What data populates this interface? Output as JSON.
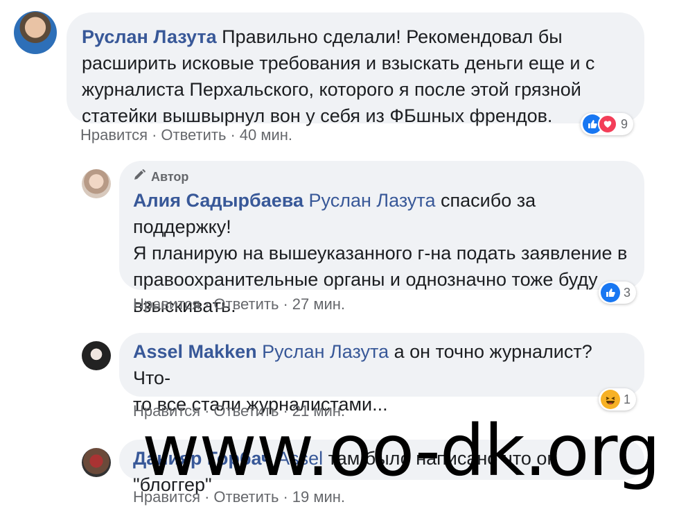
{
  "comments": [
    {
      "author": "Руслан Лазута",
      "mention": "",
      "line1": "Правильно сделали! Рекомендовал бы",
      "lines": [
        "расширить исковые требования и взыскать деньги еще и с",
        "журналиста Перхальского, которого я после этой грязной",
        "статейки вышвырнул вон у себя из ФБшных френдов."
      ],
      "actions": {
        "like": "Нравится",
        "reply": "Ответить",
        "time": "40 мин."
      },
      "reaction_count": "9"
    },
    {
      "badge": "Автор",
      "author": "Алия Садырбаева",
      "mention": "Руслан Лазута",
      "line1": "спасибо за поддержку!",
      "lines": [
        "Я планирую на вышеуказанного г-на подать заявление в",
        "правоохранительные органы и однозначно тоже буду",
        "взыскивать."
      ],
      "actions": {
        "like": "Нравится",
        "reply": "Ответить",
        "time": "27 мин."
      },
      "reaction_count": "3"
    },
    {
      "author": "Assel Makken",
      "mention": "Руслан Лазута",
      "line1": "а он точно журналист? Что-",
      "lines": [
        "то все стали журналистами..."
      ],
      "actions": {
        "like": "Нравится",
        "reply": "Ответить",
        "time": "21 мин."
      },
      "reaction_count": "1"
    },
    {
      "author": "Данияр Горбач",
      "mention": "Assel",
      "line1": "там было написано что он \"блоггер\"",
      "actions": {
        "like": "Нравится",
        "reply": "Ответить",
        "time": "19 мин."
      }
    }
  ],
  "watermark": "www.oo-dk.org",
  "colors": {
    "link": "#385898",
    "bubble": "#f0f2f5",
    "like": "#1877f2",
    "love": "#f33e58",
    "haha": "#f7b125"
  }
}
